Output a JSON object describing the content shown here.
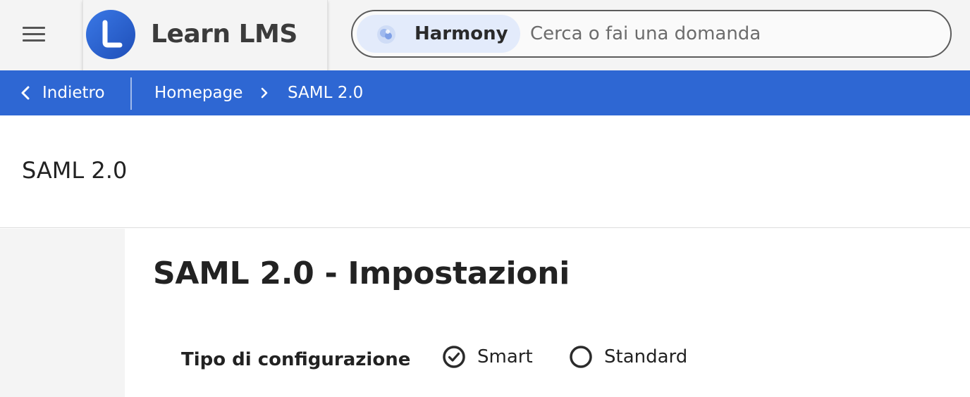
{
  "app": {
    "name": "Learn LMS",
    "brand_color": "#2e67d3"
  },
  "header": {
    "menu_icon": "hamburger-menu-icon",
    "logo_icon": "learn-lms-logo-icon",
    "search": {
      "assistant_label": "Harmony",
      "assistant_icon": "harmony-sparkle-icon",
      "placeholder": "Cerca o fai una domanda",
      "value": ""
    }
  },
  "breadcrumb": {
    "back_label": "Indietro",
    "back_icon": "chevron-left-icon",
    "items": [
      "Homepage",
      "SAML 2.0"
    ],
    "separator_icon": "chevron-right-icon"
  },
  "page": {
    "title": "SAML 2.0"
  },
  "settings": {
    "section_title": "SAML 2.0 - Impostazioni",
    "config_type": {
      "label": "Tipo di configurazione",
      "options": [
        "Smart",
        "Standard"
      ],
      "selected": "Smart"
    }
  }
}
